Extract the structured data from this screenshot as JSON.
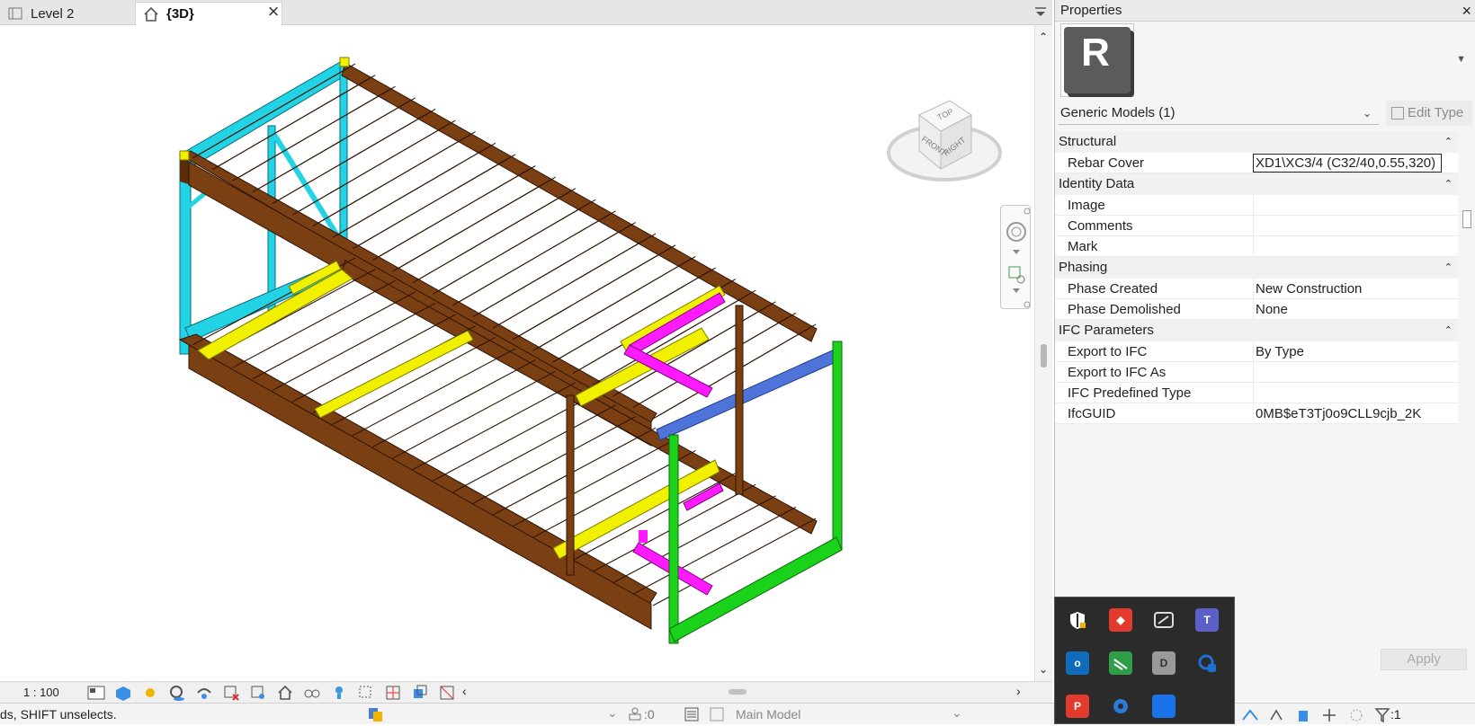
{
  "tabs": [
    {
      "label": "Level 2",
      "icon": "floor-plan-icon"
    },
    {
      "label": "{3D}",
      "icon": "home-3d-icon"
    }
  ],
  "viewcube": {
    "top": "TOP",
    "front": "FRONT",
    "right": "RIGHT"
  },
  "view_bar": {
    "scale": "1 : 100",
    "icons": [
      "detail-level-icon",
      "visual-style-icon",
      "sun-path-icon",
      "shadows-icon",
      "render-icon",
      "crop-view-icon",
      "show-crop-icon",
      "unlock-3d-view-icon",
      "temporary-hide-icon",
      "reveal-hidden-icon",
      "temporary-view-properties-icon",
      "hide-analytical-model-icon",
      "highlight-displacement-icon",
      "reveal-constraints-icon"
    ]
  },
  "status": {
    "message": "ds, SHIFT unselects.",
    "worksets_count": ":0",
    "model": "Main Model",
    "filter_count": ":1"
  },
  "properties": {
    "title": "Properties",
    "type_logo_letter": "R",
    "selector": "Generic Models (1)",
    "edit_type": "Edit Type",
    "apply": "Apply",
    "groups": [
      {
        "name": "Structural",
        "rows": [
          {
            "key": "Rebar Cover",
            "value": "XD1\\XC3/4 (C32/40,0.55,320)"
          }
        ]
      },
      {
        "name": "Identity Data",
        "rows": [
          {
            "key": "Image",
            "value": ""
          },
          {
            "key": "Comments",
            "value": ""
          },
          {
            "key": "Mark",
            "value": ""
          }
        ]
      },
      {
        "name": "Phasing",
        "rows": [
          {
            "key": "Phase Created",
            "value": "New Construction"
          },
          {
            "key": "Phase Demolished",
            "value": "None"
          }
        ]
      },
      {
        "name": "IFC Parameters",
        "rows": [
          {
            "key": "Export to IFC",
            "value": "By Type"
          },
          {
            "key": "Export to IFC As",
            "value": ""
          },
          {
            "key": "IFC Predefined Type",
            "value": ""
          },
          {
            "key": "IfcGUID",
            "value": "0MB$eT3Tj0o9CLL9cjb_2K"
          }
        ]
      }
    ]
  },
  "tray": {
    "icons": [
      {
        "name": "security-shield-icon",
        "color": "#ffffff"
      },
      {
        "name": "anydesk-icon",
        "color": "#e23b2e"
      },
      {
        "name": "speed-meter-icon",
        "color": "#dddddd"
      },
      {
        "name": "teams-icon",
        "color": "#5b5fc7"
      },
      {
        "name": "outlook-icon",
        "color": "#0f6cbd"
      },
      {
        "name": "graphisoft-icon",
        "color": "#2e9e48"
      },
      {
        "name": "dwg-icon",
        "color": "#9a9a9a"
      },
      {
        "name": "revit-sync-icon",
        "color": "#1f6fd1"
      },
      {
        "name": "presentation-app-icon",
        "color": "#e23b2e"
      },
      {
        "name": "settings-gear-icon",
        "color": "#2b7bd6"
      },
      {
        "name": "blue-app-icon",
        "color": "#1a73e8"
      }
    ]
  },
  "colors": {
    "timber": "#7a3f12",
    "cyan": "#22d3e6",
    "yellow": "#f0f000",
    "magenta": "#ff1aff",
    "blue": "#4f74d9",
    "green": "#19d219"
  }
}
